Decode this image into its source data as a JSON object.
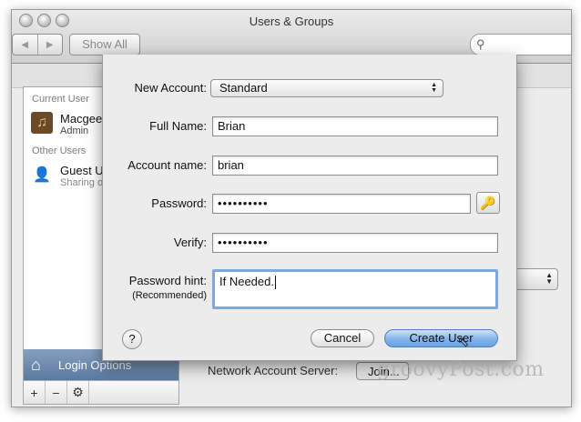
{
  "window": {
    "title": "Users & Groups"
  },
  "toolbar": {
    "back_glyph": "◀",
    "forward_glyph": "▶",
    "show_all": "Show All",
    "search_placeholder": ""
  },
  "sidebar": {
    "current_user_header": "Current User",
    "current_user": {
      "name": "Macgeek",
      "role": "Admin"
    },
    "other_users_header": "Other Users",
    "guest_user": {
      "name": "Guest U",
      "sub": "Sharing o"
    },
    "login_options": "Login Options",
    "buttons": {
      "add": "+",
      "remove": "−",
      "settings": "⚙"
    }
  },
  "background_panel": {
    "network_label": "Network Account Server:",
    "join_label": "Join..."
  },
  "sheet": {
    "new_account_label": "New Account:",
    "new_account_value": "Standard",
    "full_name_label": "Full Name:",
    "full_name_value": "Brian",
    "account_name_label": "Account name:",
    "account_name_value": "brian",
    "password_label": "Password:",
    "password_value": "••••••••••",
    "verify_label": "Verify:",
    "verify_value": "••••••••••",
    "hint_label": "Password hint:",
    "hint_recommended": "(Recommended)",
    "hint_value": "If Needed.",
    "help": "?",
    "cancel": "Cancel",
    "create_user": "Create User"
  },
  "watermark": "groovyPost.com",
  "colors": {
    "default_button": "#6ba3e6",
    "focus_ring": "#7fa7dc",
    "sidebar_selected": "#5a79a0"
  }
}
